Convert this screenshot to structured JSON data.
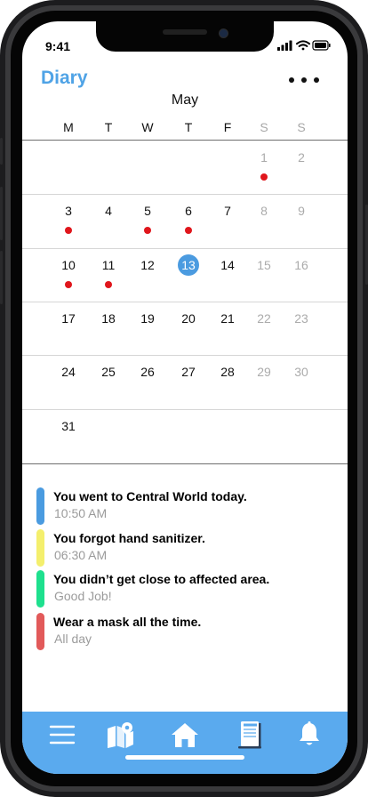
{
  "status": {
    "time": "9:41"
  },
  "header": {
    "title": "Diary",
    "more_icon": "ellipsis-icon"
  },
  "calendar": {
    "month": "May",
    "weekdays": [
      "M",
      "T",
      "W",
      "T",
      "F",
      "S",
      "S"
    ],
    "today": "13",
    "event_days": [
      "1",
      "3",
      "5",
      "6",
      "10",
      "11"
    ],
    "event_dot_color": "#e0161c",
    "weeks": [
      [
        "",
        "",
        "",
        "",
        "",
        "1",
        "2"
      ],
      [
        "3",
        "4",
        "5",
        "6",
        "7",
        "8",
        "9"
      ],
      [
        "10",
        "11",
        "12",
        "13",
        "14",
        "15",
        "16"
      ],
      [
        "17",
        "18",
        "19",
        "20",
        "21",
        "22",
        "23"
      ],
      [
        "24",
        "25",
        "26",
        "27",
        "28",
        "29",
        "30"
      ],
      [
        "31",
        "",
        "",
        "",
        "",
        "",
        ""
      ]
    ]
  },
  "entries": [
    {
      "title": "You went to Central World today.",
      "subtitle": "10:50 AM",
      "color": "#4a9be0"
    },
    {
      "title": "You forgot hand sanitizer.",
      "subtitle": "06:30 AM",
      "color": "#f4ef6d"
    },
    {
      "title": "You didn’t get close to affected area.",
      "subtitle": "Good Job!",
      "color": "#1ee08e"
    },
    {
      "title": "Wear a mask all the time.",
      "subtitle": "All day",
      "color": "#e25a5a"
    }
  ],
  "tabbar": {
    "color": "#5aaaee",
    "tabs": [
      "menu-icon",
      "map-icon",
      "home-icon",
      "notebook-icon",
      "bell-icon"
    ]
  }
}
